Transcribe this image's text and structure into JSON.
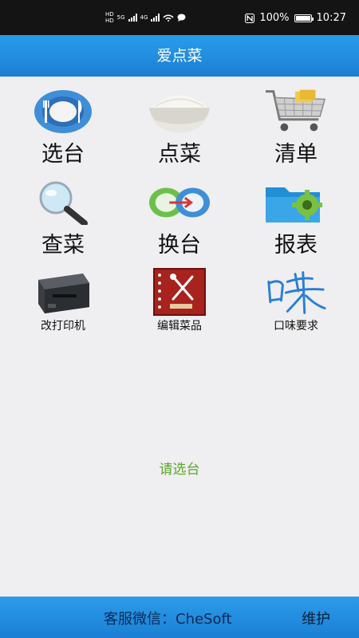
{
  "status_bar": {
    "left_labels": [
      "HD",
      "HD",
      "5G",
      "4G"
    ],
    "battery_text": "100%",
    "battery_level": 1.0,
    "time": "10:27"
  },
  "header": {
    "title": "爱点菜"
  },
  "menu": [
    {
      "label": "选台",
      "icon": "plate-icon"
    },
    {
      "label": "点菜",
      "icon": "rice-bowl-icon"
    },
    {
      "label": "清单",
      "icon": "shopping-cart-icon"
    },
    {
      "label": "查菜",
      "icon": "magnifier-icon"
    },
    {
      "label": "换台",
      "icon": "swap-plates-icon"
    },
    {
      "label": "报表",
      "icon": "folder-gear-icon"
    },
    {
      "label": "改打印机",
      "icon": "printer-icon"
    },
    {
      "label": "编辑菜品",
      "icon": "menu-book-icon"
    },
    {
      "label": "口味要求",
      "icon": "taste-calligraphy-icon"
    }
  ],
  "prompt": "请选台",
  "footer": {
    "contact": "客服微信：CheSoft",
    "maintenance": "维护"
  },
  "colors": {
    "bar_blue": "#1e88e5",
    "prompt_green": "#5aa82a",
    "background": "#efeef0"
  }
}
